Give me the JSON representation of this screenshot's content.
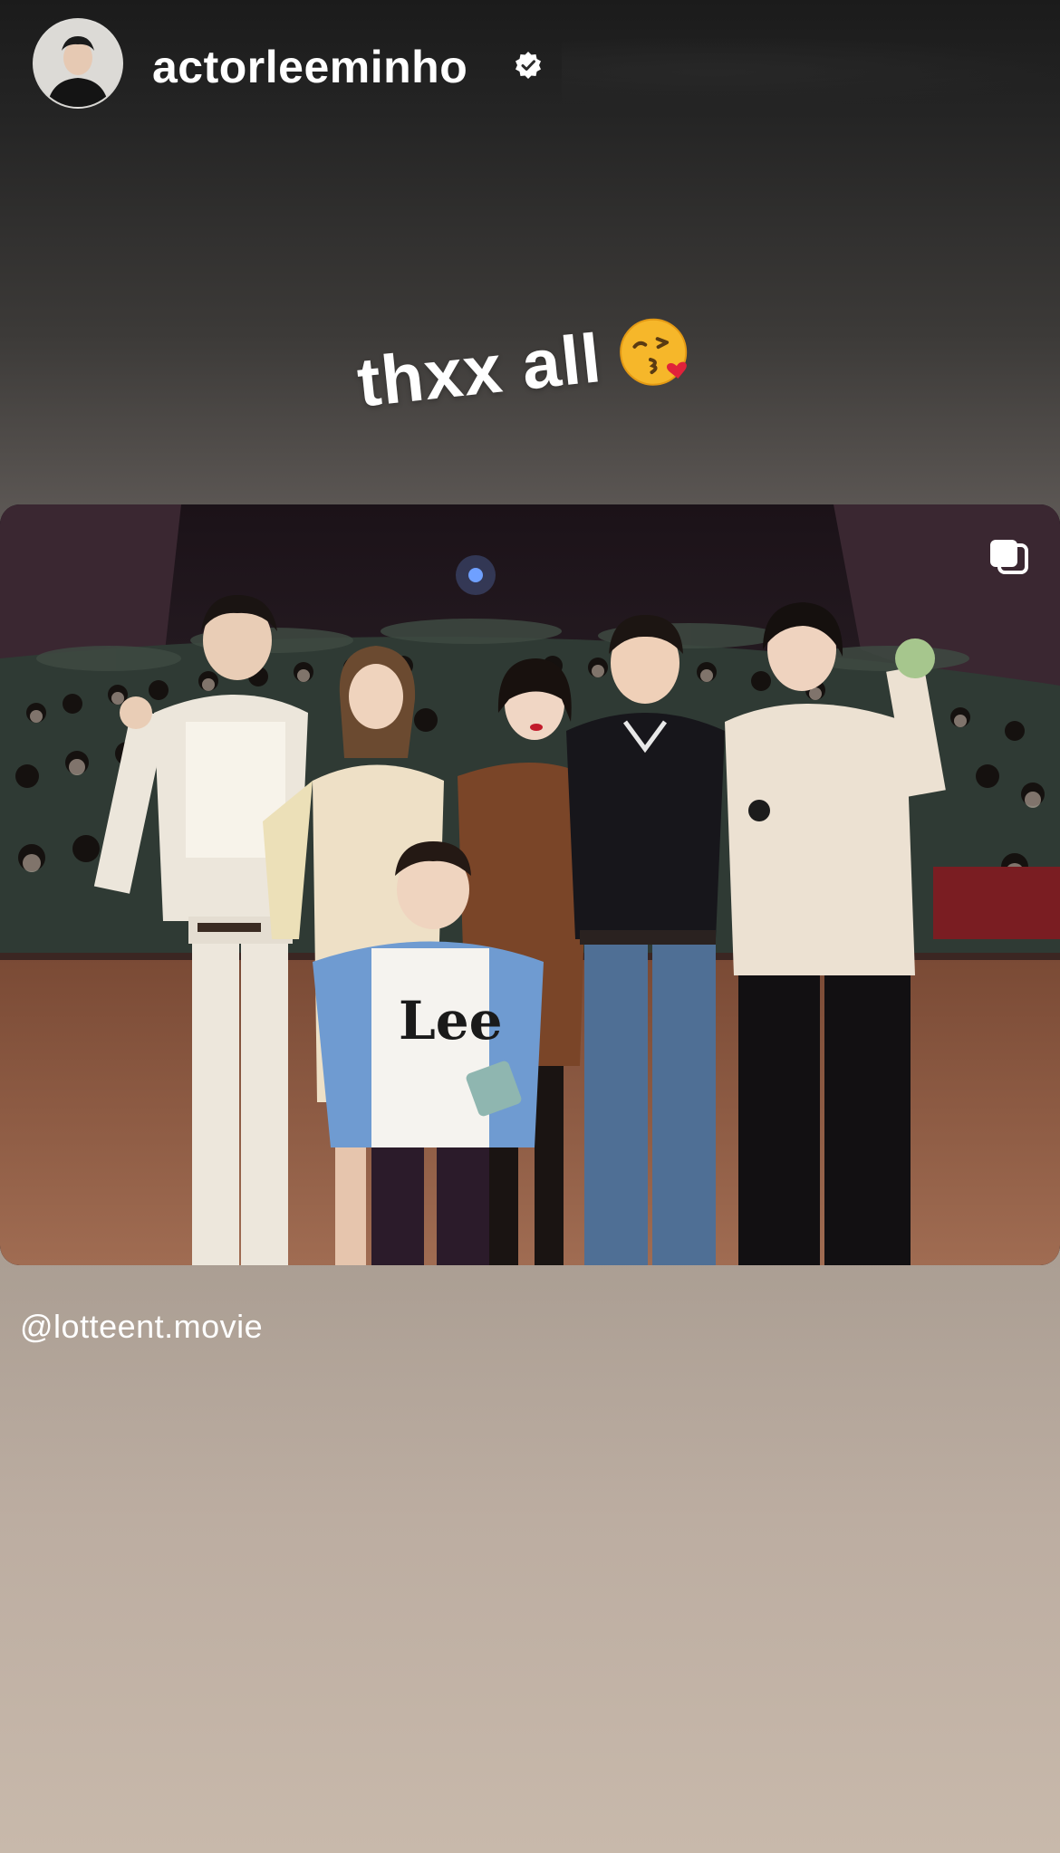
{
  "header": {
    "username": "actorleeminho",
    "timestamp": "",
    "verified_icon": "verified-badge-icon"
  },
  "sticker": {
    "text": "thxx all",
    "emoji": "face-blowing-a-kiss"
  },
  "post": {
    "multi_image_icon": "carousel-icon",
    "mention": "@lotteent.movie",
    "shirt_print": "Lee"
  },
  "colors": {
    "background_top": "#1b1b1b",
    "background_bottom": "#c8b9ab",
    "text": "#ffffff"
  }
}
